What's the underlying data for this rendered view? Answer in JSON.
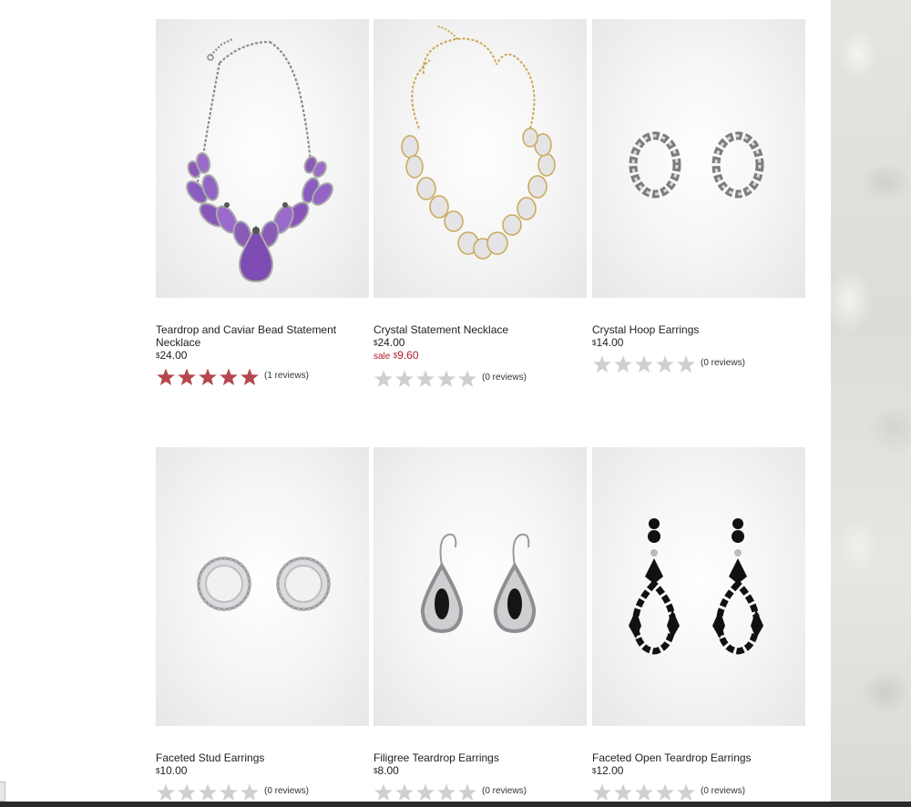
{
  "products": [
    {
      "name": "Teardrop and Caviar Bead Statement Necklace",
      "price_currency": "$",
      "price": "24.00",
      "sale_label": "",
      "sale_currency": "",
      "sale_price": "",
      "rating": 5,
      "reviews": "(1 reviews)",
      "image": "purple-statement-necklace"
    },
    {
      "name": "Crystal Statement Necklace",
      "price_currency": "$",
      "price": "24.00",
      "sale_label": "sale",
      "sale_currency": "$",
      "sale_price": "9.60",
      "rating": 0,
      "reviews": "(0 reviews)",
      "image": "gold-crystal-necklace"
    },
    {
      "name": "Crystal Hoop Earrings",
      "price_currency": "$",
      "price": "14.00",
      "sale_label": "",
      "sale_currency": "",
      "sale_price": "",
      "rating": 0,
      "reviews": "(0 reviews)",
      "image": "crystal-hoop-earrings"
    },
    {
      "name": "Faceted Stud Earrings",
      "price_currency": "$",
      "price": "10.00",
      "sale_label": "",
      "sale_currency": "",
      "sale_price": "",
      "rating": 0,
      "reviews": "(0 reviews)",
      "image": "faceted-stud-earrings"
    },
    {
      "name": "Filigree Teardrop Earrings",
      "price_currency": "$",
      "price": "8.00",
      "sale_label": "",
      "sale_currency": "",
      "sale_price": "",
      "rating": 0,
      "reviews": "(0 reviews)",
      "image": "filigree-teardrop-earrings"
    },
    {
      "name": "Faceted Open Teardrop Earrings",
      "price_currency": "$",
      "price": "12.00",
      "sale_label": "",
      "sale_currency": "",
      "sale_price": "",
      "rating": 0,
      "reviews": "(0 reviews)",
      "image": "black-open-teardrop-earrings"
    }
  ],
  "colors": {
    "star_filled": "#b5474f",
    "star_empty": "#cfcfcf",
    "sale": "#b01d2b"
  }
}
